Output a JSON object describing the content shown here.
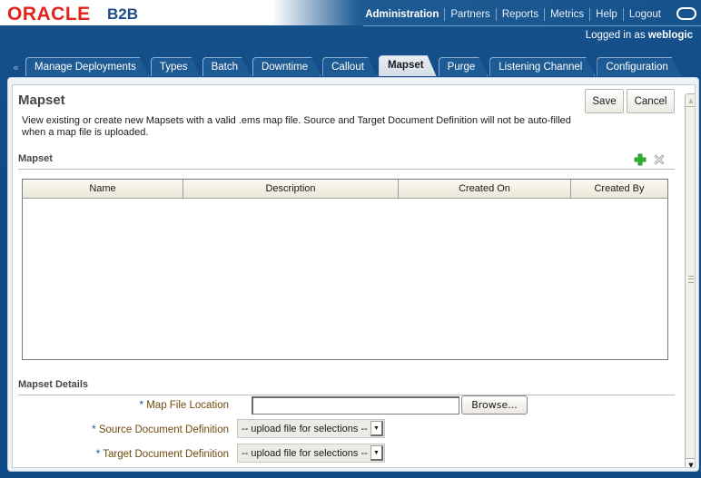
{
  "header": {
    "brand": "ORACLE",
    "product": "B2B",
    "global_nav": [
      {
        "label": "Administration",
        "active": true
      },
      {
        "label": "Partners",
        "active": false
      },
      {
        "label": "Reports",
        "active": false
      },
      {
        "label": "Metrics",
        "active": false
      },
      {
        "label": "Help",
        "active": false
      },
      {
        "label": "Logout",
        "active": false
      }
    ],
    "logged_in_prefix": "Logged in as",
    "logged_in_user": "weblogic",
    "scroll_icon": "«"
  },
  "tabs": [
    {
      "label": "Manage Deployments",
      "active": false
    },
    {
      "label": "Types",
      "active": false
    },
    {
      "label": "Batch",
      "active": false
    },
    {
      "label": "Downtime",
      "active": false
    },
    {
      "label": "Callout",
      "active": false
    },
    {
      "label": "Mapset",
      "active": true
    },
    {
      "label": "Purge",
      "active": false
    },
    {
      "label": "Listening Channel",
      "active": false
    },
    {
      "label": "Configuration",
      "active": false
    }
  ],
  "page": {
    "title": "Mapset",
    "description": "View existing or create new Mapsets with a valid .ems map file. Source and Target Document Definition will not be auto-filled when a map file is uploaded.",
    "save_label": "Save",
    "cancel_label": "Cancel"
  },
  "mapset_section": {
    "title": "Mapset",
    "add_icon": "add-icon",
    "delete_icon": "delete-icon",
    "table": {
      "columns": [
        "Name",
        "Description",
        "Created On",
        "Created By"
      ],
      "rows": []
    }
  },
  "details_section": {
    "title": "Mapset Details",
    "required_marker": "*",
    "map_file_label": "Map File Location",
    "map_file_value": "",
    "browse_label": "Browse...",
    "source_label": "Source Document Definition",
    "source_value": "-- upload file for selections --",
    "target_label": "Target Document Definition",
    "target_value": "-- upload file for selections --"
  },
  "colors": {
    "brand_red": "#e3221b",
    "header_blue": "#0f4d88",
    "label_brown": "#6e4a0c",
    "add_green": "#2db52d"
  }
}
